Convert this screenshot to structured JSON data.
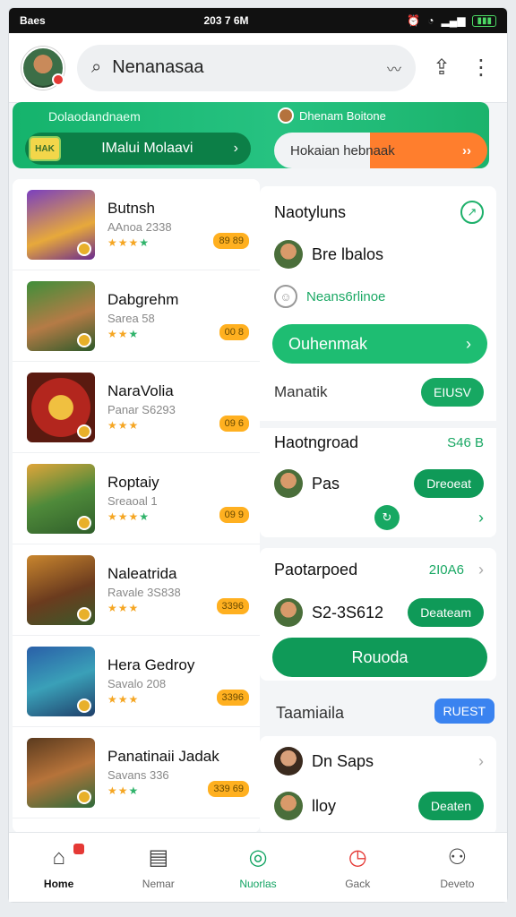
{
  "status": {
    "left": "Baes",
    "time": "203 7 6M",
    "battery": ""
  },
  "header": {
    "search_label": "Nenanasaa"
  },
  "banner": {
    "left_title": "Dolaodandnaem",
    "left_pill": "IMalui Molaavi",
    "chip": "HAK",
    "right_title": "Dhenam Boitone",
    "right_cta": "Hokaian hebnaak",
    "right_cta_arrow": "››"
  },
  "games": [
    {
      "name": "Butnsh",
      "sub": "AAnoa 2338",
      "price": "89 89"
    },
    {
      "name": "Dabgrehm",
      "sub": "Sarea 58",
      "price": "00 8"
    },
    {
      "name": "NaraVolia",
      "sub": "Panar S6293",
      "price": "09 6"
    },
    {
      "name": "Roptaiy",
      "sub": "Sreaoal 1",
      "price": "09 9"
    },
    {
      "name": "Naleatrida",
      "sub": "Ravale 3S838",
      "price": "3396"
    },
    {
      "name": "Hera Gedroy",
      "sub": "Savalo 208",
      "price": "3396"
    },
    {
      "name": "Panatinaii Jadak",
      "sub": "Savans 336",
      "price": "339 69"
    }
  ],
  "panel1": {
    "title": "Naotyluns",
    "user": "Bre lbalos",
    "green": "Neans6rlinoe",
    "button": "Ouhenmak",
    "section": "Manatik",
    "section_btn": "EIUSV",
    "title2": "Haotngroad",
    "title2_val": "S46 B",
    "user2": "Pas",
    "user2_btn": "Dreoeat"
  },
  "panel2": {
    "title": "Paotarpoed",
    "value": "2I0A6",
    "user": "S2-3S612",
    "user_btn": "Deateam",
    "button": "Rouoda"
  },
  "section3": {
    "label": "Taamiaila",
    "badge": "RUEST"
  },
  "panel3": {
    "user1": "Dn Saps",
    "user2": "lloy",
    "user2_btn": "Deaten"
  },
  "nav": [
    {
      "label": "Home"
    },
    {
      "label": "Nemar"
    },
    {
      "label": "Nuorlas"
    },
    {
      "label": "Gack"
    },
    {
      "label": "Deveto"
    }
  ]
}
